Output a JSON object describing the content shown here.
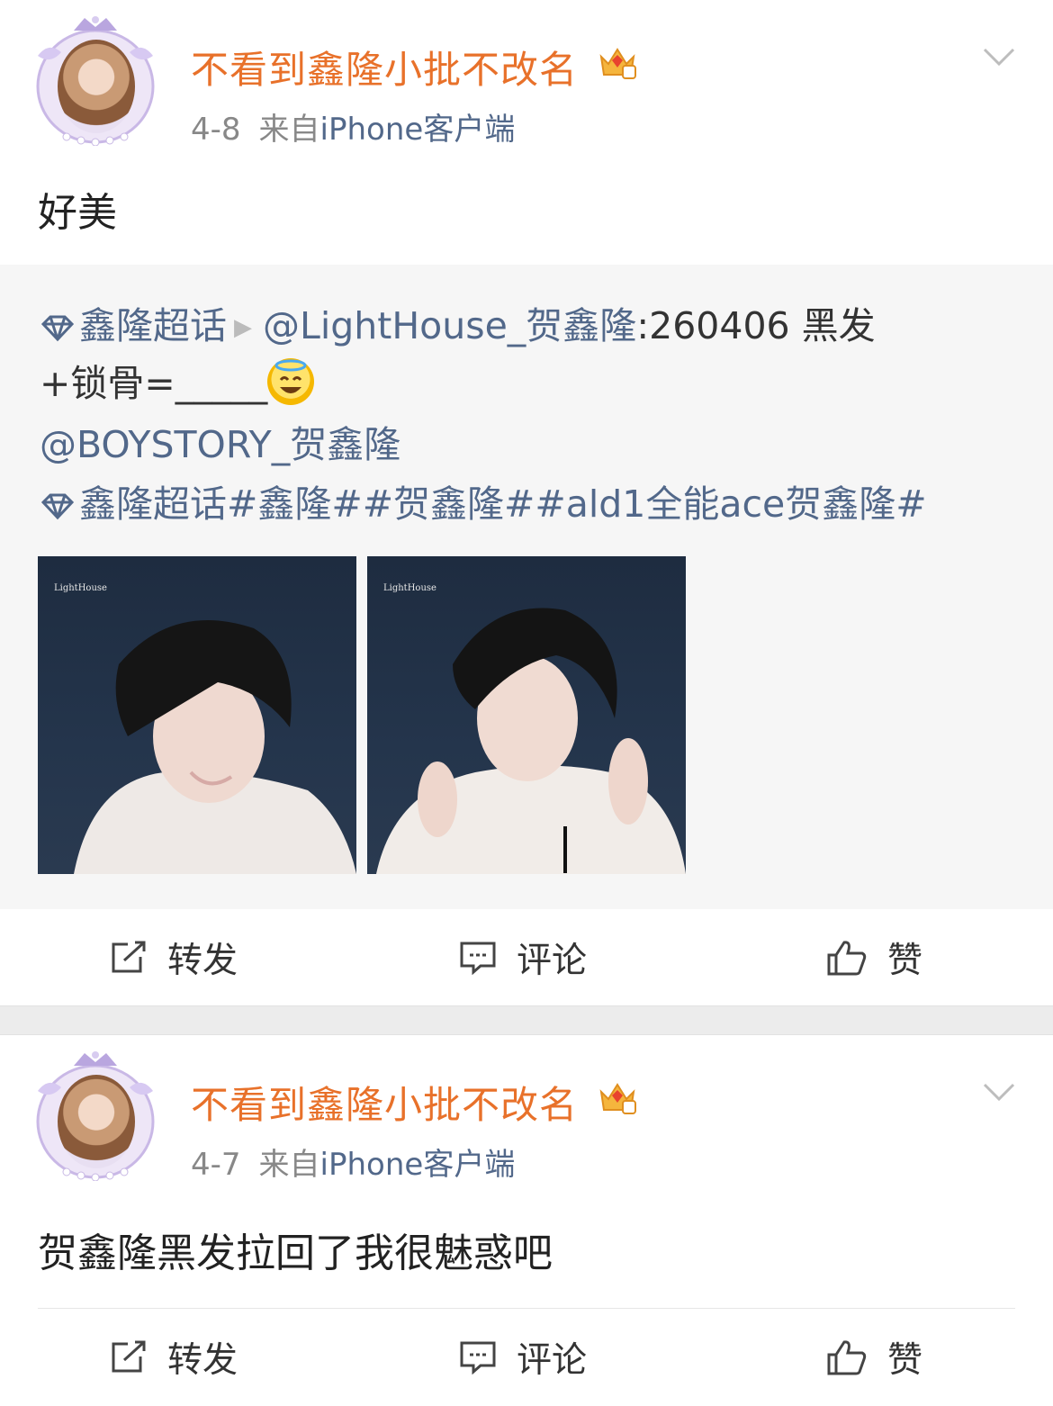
{
  "posts": [
    {
      "username": "不看到鑫隆小批不改名",
      "date": "4-8",
      "source_prefix": "来自",
      "source": "iPhone客户端",
      "text": "好美",
      "repost": {
        "topic": "鑫隆超话",
        "author": "@LightHouse_贺鑫隆",
        "content_a": ":260406 黑发",
        "content_b": "+锁骨=_____",
        "mention": "@BOYSTORY_贺鑫隆",
        "topic2": "鑫隆超话",
        "hashtags": "#鑫隆##贺鑫隆##ald1全能ace贺鑫隆#",
        "watermark": "LightHouse"
      }
    },
    {
      "username": "不看到鑫隆小批不改名",
      "date": "4-7",
      "source_prefix": "来自",
      "source": "iPhone客户端",
      "text": "贺鑫隆黑发拉回了我很魅惑吧"
    }
  ],
  "actions": {
    "repost": "转发",
    "comment": "评论",
    "like": "赞"
  },
  "icons": [
    "more-chevron-icon",
    "vip-crown-icon",
    "supertopic-diamond-icon",
    "repost-icon",
    "comment-icon",
    "like-icon",
    "halo-smile-emoji-icon"
  ],
  "colors": {
    "username": "#e8712a",
    "link": "#52688a",
    "meta": "#888888",
    "repost_bg": "#f6f6f6"
  }
}
